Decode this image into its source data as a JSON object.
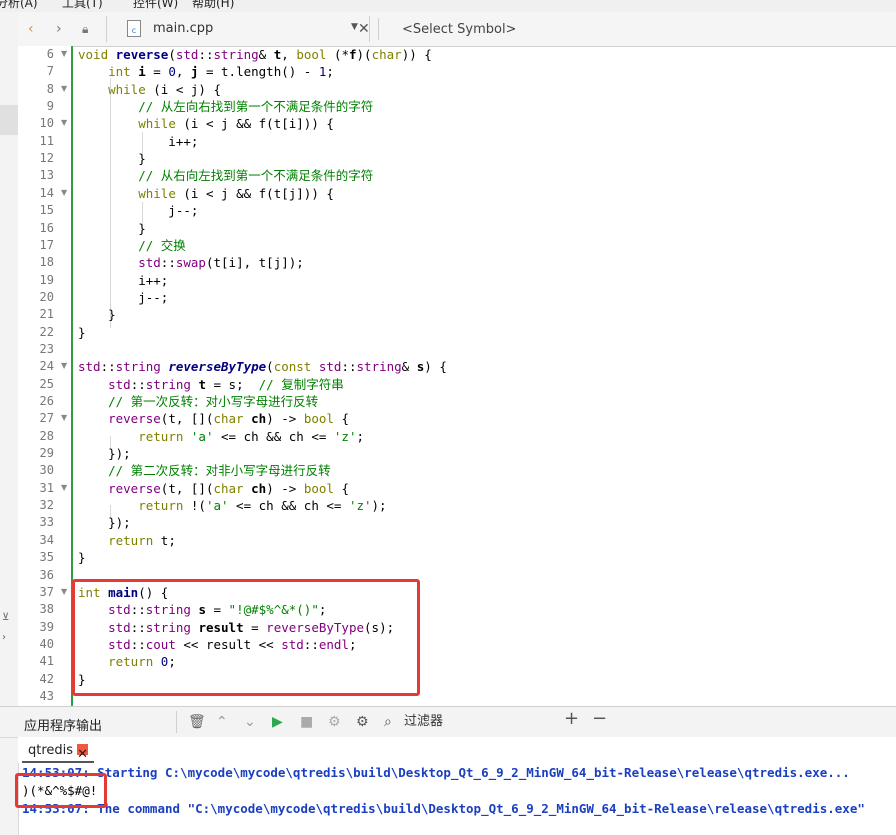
{
  "menubar": {
    "items": [
      "分析(A)",
      "工具(T)",
      "控件(W)",
      "帮助(H)"
    ]
  },
  "editor_toolbar": {
    "file_name": "main.cpp",
    "symbol_placeholder": "<Select Symbol>",
    "back_icon": "chevron-left-icon",
    "forward_icon": "chevron-right-icon",
    "lock_icon": "lock-icon",
    "file_icon": "cpp-file-icon",
    "close_icon": "close-icon"
  },
  "code_lines": [
    {
      "n": "6",
      "fold": true,
      "html": "<span class='kw'>void</span> <span class='fn'>reverse</span>(<span class='ty'>std</span>::<span class='ty'>string</span>&amp; <b>t</b>, <span class='kw'>bool</span> (*<b>f</b>)(<span class='kw'>char</span>)) {"
    },
    {
      "n": "7",
      "html": "    <span class='kw'>int</span> <b>i</b> = <span class='num'>0</span>, <b>j</b> = t.length() - <span class='num'>1</span>;"
    },
    {
      "n": "8",
      "fold": true,
      "html": "    <span class='kw'>while</span> (i &lt; j) {"
    },
    {
      "n": "9",
      "html": "        <span class='cm'>// 从左向右找到第一个不满足条件的字符</span>"
    },
    {
      "n": "10",
      "fold": true,
      "html": "        <span class='kw'>while</span> (i &lt; j &amp;&amp; f(t[i])) {"
    },
    {
      "n": "11",
      "html": "            i++;"
    },
    {
      "n": "12",
      "html": "        }"
    },
    {
      "n": "13",
      "html": "        <span class='cm'>// 从右向左找到第一个不满足条件的字符</span>"
    },
    {
      "n": "14",
      "fold": true,
      "html": "        <span class='kw'>while</span> (i &lt; j &amp;&amp; f(t[j])) {"
    },
    {
      "n": "15",
      "html": "            j--;"
    },
    {
      "n": "16",
      "html": "        }"
    },
    {
      "n": "17",
      "html": "        <span class='cm'>// 交换</span>"
    },
    {
      "n": "18",
      "html": "        <span class='ty'>std</span>::<span class='ty'>swap</span>(t[i], t[j]);"
    },
    {
      "n": "19",
      "html": "        i++;"
    },
    {
      "n": "20",
      "html": "        j--;"
    },
    {
      "n": "21",
      "html": "    }"
    },
    {
      "n": "22",
      "html": "}"
    },
    {
      "n": "23",
      "html": ""
    },
    {
      "n": "24",
      "fold": true,
      "html": "<span class='ty'>std</span>::<span class='ty'>string</span> <span class='fn'><i>reverseByType</i></span>(<span class='kw'>const</span> <span class='ty'>std</span>::<span class='ty'>string</span>&amp; <b>s</b>) {"
    },
    {
      "n": "25",
      "html": "    <span class='ty'>std</span>::<span class='ty'>string</span> <b>t</b> = s;  <span class='cm'>// 复制字符串</span>"
    },
    {
      "n": "26",
      "html": "    <span class='cm'>// 第一次反转：对小写字母进行反转</span>"
    },
    {
      "n": "27",
      "fold": true,
      "html": "    <span class='ty'>reverse</span>(t, [](<span class='kw'>char</span> <b>ch</b>) -&gt; <span class='kw'>bool</span> {"
    },
    {
      "n": "28",
      "html": "        <span class='kw'>return</span> <span class='str'>'a'</span> &lt;= ch &amp;&amp; ch &lt;= <span class='str'>'z'</span>;"
    },
    {
      "n": "29",
      "html": "    });"
    },
    {
      "n": "30",
      "html": "    <span class='cm'>// 第二次反转：对非小写字母进行反转</span>"
    },
    {
      "n": "31",
      "fold": true,
      "html": "    <span class='ty'>reverse</span>(t, [](<span class='kw'>char</span> <b>ch</b>) -&gt; <span class='kw'>bool</span> {"
    },
    {
      "n": "32",
      "html": "        <span class='kw'>return</span> !(<span class='str'>'a'</span> &lt;= ch &amp;&amp; ch &lt;= <span class='str'>'z'</span>);"
    },
    {
      "n": "33",
      "html": "    });"
    },
    {
      "n": "34",
      "html": "    <span class='kw'>return</span> t;"
    },
    {
      "n": "35",
      "html": "}"
    },
    {
      "n": "36",
      "html": ""
    },
    {
      "n": "37",
      "fold": true,
      "html": "<span class='kw'>int</span> <span class='fn'>main</span>() {"
    },
    {
      "n": "38",
      "html": "    <span class='ty'>std</span>::<span class='ty'>string</span> <b>s</b> = <span class='str'>\"!@#$%^&amp;*()\"</span>;"
    },
    {
      "n": "39",
      "html": "    <span class='ty'>std</span>::<span class='ty'>string</span> <b>result</b> = <span class='ty'>reverseByType</span>(s);"
    },
    {
      "n": "40",
      "html": "    <span class='ty'>std</span>::<span class='ty'>cout</span> &lt;&lt; result &lt;&lt; <span class='ty'>std</span>::<span class='ty'>endl</span>;"
    },
    {
      "n": "41",
      "html": "    <span class='kw'>return</span> <span class='num'>0</span>;"
    },
    {
      "n": "42",
      "html": "}"
    },
    {
      "n": "43",
      "html": ""
    }
  ],
  "output_panel": {
    "title": "应用程序输出",
    "filter_placeholder": "过滤器",
    "tab_name": "qtredis",
    "lines": [
      "14:53:07: Starting C:\\mycode\\mycode\\qtredis\\build\\Desktop_Qt_6_9_2_MinGW_64_bit-Release\\release\\qtredis.exe...",
      ")(*&^%$#@!",
      "14:53:07: The command \"C:\\mycode\\mycode\\qtredis\\build\\Desktop_Qt_6_9_2_MinGW_64_bit-Release\\release\\qtredis.exe\""
    ]
  },
  "colors": {
    "highlight_box": "#e53935",
    "green_bar": "#2e9e3e",
    "output_blue": "#1a3fbf"
  }
}
